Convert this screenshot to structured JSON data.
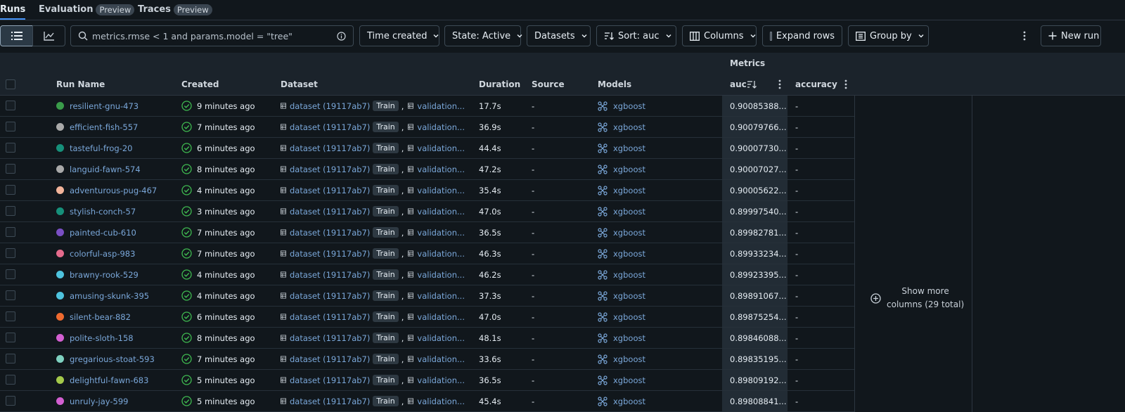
{
  "tabs": [
    {
      "label": "Runs",
      "badge": ""
    },
    {
      "label": "Evaluation",
      "badge": "Preview"
    },
    {
      "label": "Traces",
      "badge": "Preview"
    }
  ],
  "toolbar": {
    "search_value": "metrics.rmse < 1 and params.model = \"tree\"",
    "time_created": "Time created",
    "state": "State: Active",
    "datasets": "Datasets",
    "sort": "Sort: auc",
    "columns": "Columns",
    "expand_rows": "Expand rows",
    "group_by": "Group by",
    "new_run": "New run"
  },
  "table": {
    "group_metrics": "Metrics",
    "headers": {
      "run_name": "Run Name",
      "created": "Created",
      "dataset": "Dataset",
      "duration": "Duration",
      "source": "Source",
      "models": "Models",
      "auc": "auc",
      "accuracy": "accuracy"
    },
    "rows": [
      {
        "name": "resilient-gnu-473",
        "color": "#3a9c4a",
        "created": "9 minutes ago",
        "dataset": "dataset (19117ab7)",
        "train": "Train",
        "validation": "validation...",
        "duration": "17.7s",
        "source": "-",
        "model": "xgboost",
        "auc": "0.90085388...",
        "accuracy": "-"
      },
      {
        "name": "efficient-fish-557",
        "color": "#a9a9a9",
        "created": "7 minutes ago",
        "dataset": "dataset (19117ab7)",
        "train": "Train",
        "validation": "validation...",
        "duration": "36.9s",
        "source": "-",
        "model": "xgboost",
        "auc": "0.90079766...",
        "accuracy": "-"
      },
      {
        "name": "tasteful-frog-20",
        "color": "#16907a",
        "created": "6 minutes ago",
        "dataset": "dataset (19117ab7)",
        "train": "Train",
        "validation": "validation...",
        "duration": "44.4s",
        "source": "-",
        "model": "xgboost",
        "auc": "0.90007730...",
        "accuracy": "-"
      },
      {
        "name": "languid-fawn-574",
        "color": "#a9a9a9",
        "created": "8 minutes ago",
        "dataset": "dataset (19117ab7)",
        "train": "Train",
        "validation": "validation...",
        "duration": "47.2s",
        "source": "-",
        "model": "xgboost",
        "auc": "0.90007027...",
        "accuracy": "-"
      },
      {
        "name": "adventurous-pug-467",
        "color": "#f2b49a",
        "created": "4 minutes ago",
        "dataset": "dataset (19117ab7)",
        "train": "Train",
        "validation": "validation...",
        "duration": "35.4s",
        "source": "-",
        "model": "xgboost",
        "auc": "0.90005622...",
        "accuracy": "-"
      },
      {
        "name": "stylish-conch-57",
        "color": "#16907a",
        "created": "3 minutes ago",
        "dataset": "dataset (19117ab7)",
        "train": "Train",
        "validation": "validation...",
        "duration": "47.0s",
        "source": "-",
        "model": "xgboost",
        "auc": "0.89997540...",
        "accuracy": "-"
      },
      {
        "name": "painted-cub-610",
        "color": "#7a4fc4",
        "created": "7 minutes ago",
        "dataset": "dataset (19117ab7)",
        "train": "Train",
        "validation": "validation...",
        "duration": "36.5s",
        "source": "-",
        "model": "xgboost",
        "auc": "0.89982781...",
        "accuracy": "-"
      },
      {
        "name": "colorful-asp-983",
        "color": "#e56b8c",
        "created": "7 minutes ago",
        "dataset": "dataset (19117ab7)",
        "train": "Train",
        "validation": "validation...",
        "duration": "46.3s",
        "source": "-",
        "model": "xgboost",
        "auc": "0.89933234...",
        "accuracy": "-"
      },
      {
        "name": "brawny-rook-529",
        "color": "#4ec3de",
        "created": "4 minutes ago",
        "dataset": "dataset (19117ab7)",
        "train": "Train",
        "validation": "validation...",
        "duration": "46.2s",
        "source": "-",
        "model": "xgboost",
        "auc": "0.89923395...",
        "accuracy": "-"
      },
      {
        "name": "amusing-skunk-395",
        "color": "#4ec3de",
        "created": "4 minutes ago",
        "dataset": "dataset (19117ab7)",
        "train": "Train",
        "validation": "validation...",
        "duration": "37.3s",
        "source": "-",
        "model": "xgboost",
        "auc": "0.89891067...",
        "accuracy": "-"
      },
      {
        "name": "silent-bear-882",
        "color": "#ef6a2f",
        "created": "6 minutes ago",
        "dataset": "dataset (19117ab7)",
        "train": "Train",
        "validation": "validation...",
        "duration": "47.0s",
        "source": "-",
        "model": "xgboost",
        "auc": "0.89875254...",
        "accuracy": "-"
      },
      {
        "name": "polite-sloth-158",
        "color": "#d35fd1",
        "created": "8 minutes ago",
        "dataset": "dataset (19117ab7)",
        "train": "Train",
        "validation": "validation...",
        "duration": "48.1s",
        "source": "-",
        "model": "xgboost",
        "auc": "0.89846088...",
        "accuracy": "-"
      },
      {
        "name": "gregarious-stoat-593",
        "color": "#7fd1c0",
        "created": "7 minutes ago",
        "dataset": "dataset (19117ab7)",
        "train": "Train",
        "validation": "validation...",
        "duration": "33.6s",
        "source": "-",
        "model": "xgboost",
        "auc": "0.89835195...",
        "accuracy": "-"
      },
      {
        "name": "delightful-fawn-683",
        "color": "#a4c94a",
        "created": "5 minutes ago",
        "dataset": "dataset (19117ab7)",
        "train": "Train",
        "validation": "validation...",
        "duration": "36.5s",
        "source": "-",
        "model": "xgboost",
        "auc": "0.89809192...",
        "accuracy": "-"
      },
      {
        "name": "unruly-jay-599",
        "color": "#d35fd1",
        "created": "5 minutes ago",
        "dataset": "dataset (19117ab7)",
        "train": "Train",
        "validation": "validation...",
        "duration": "45.4s",
        "source": "-",
        "model": "xgboost",
        "auc": "0.89808841...",
        "accuracy": "-"
      }
    ],
    "show_more_line1": "Show more",
    "show_more_line2": "columns (29 total)"
  },
  "icons": {
    "list": "list-icon",
    "chart": "chart-icon",
    "search": "search-icon",
    "info": "info-icon",
    "sort": "sort-icon",
    "columns": "columns-icon",
    "group": "group-icon",
    "kebab": "kebab-icon",
    "plus": "plus-icon",
    "check_circle": "check-circle-icon",
    "table": "table-icon",
    "model": "model-icon"
  },
  "colors": {
    "accent": "#4493f8",
    "link": "#7aa7d9",
    "success": "#3fb950"
  }
}
